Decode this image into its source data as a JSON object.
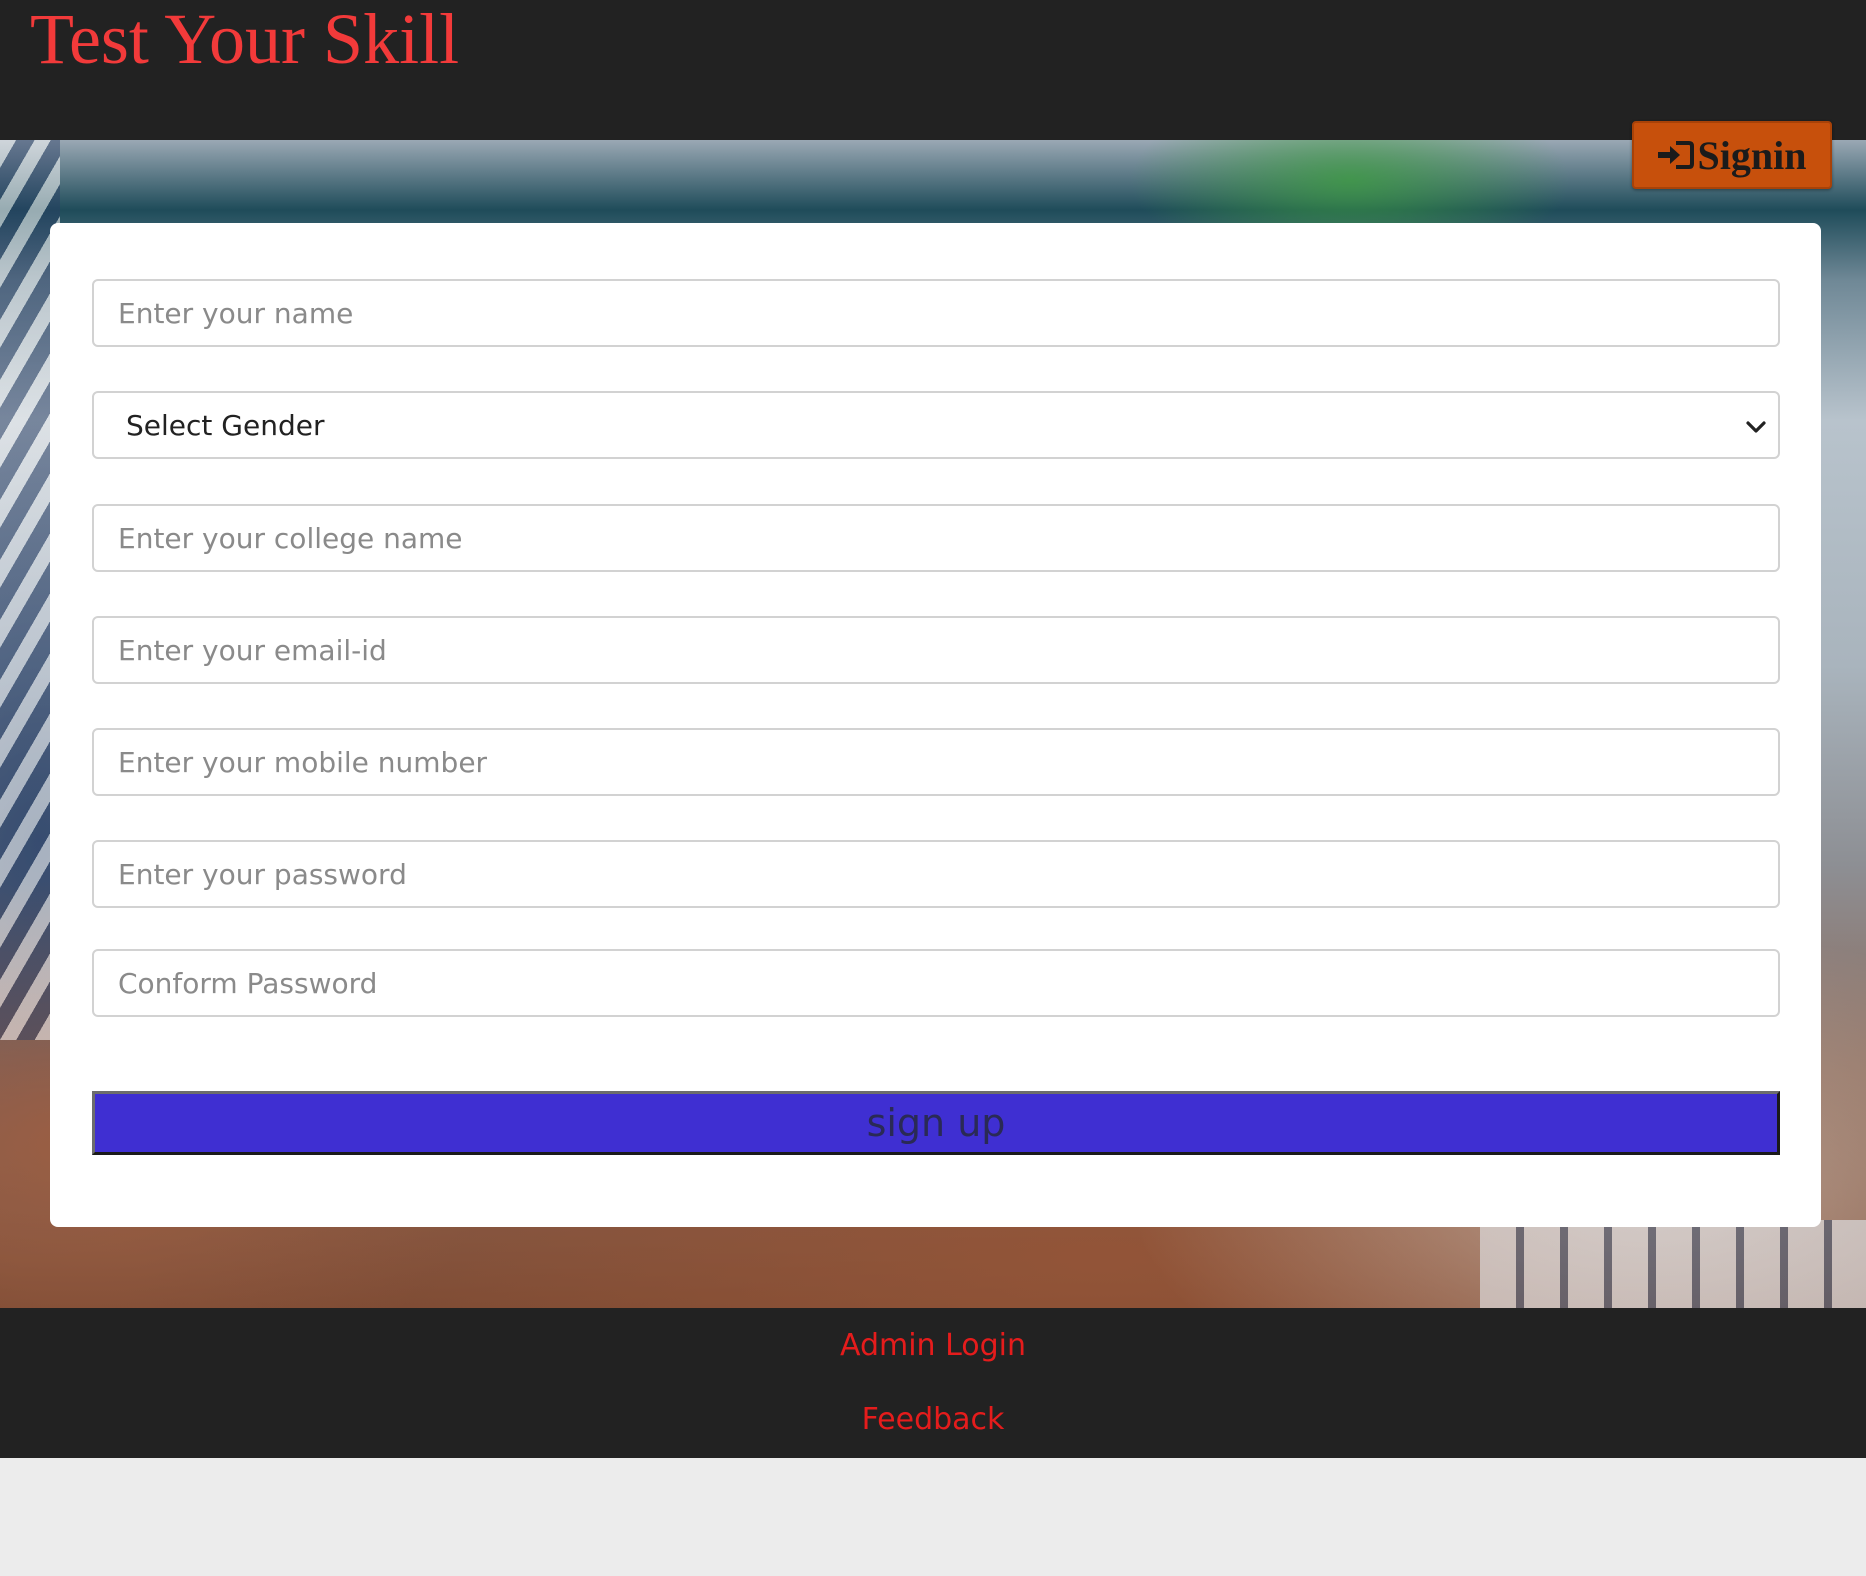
{
  "header": {
    "title": "Test Your Skill",
    "signin_label": "Signin"
  },
  "form": {
    "name_placeholder": "Enter your name",
    "gender_selected": "Select Gender",
    "college_placeholder": "Enter your college name",
    "email_placeholder": "Enter your email-id",
    "mobile_placeholder": "Enter your mobile number",
    "password_placeholder": "Enter your password",
    "confirm_placeholder": "Conform Password",
    "submit_label": "sign up"
  },
  "footer": {
    "links": [
      "Admin Login",
      "Feedback"
    ]
  },
  "colors": {
    "header_bg": "#222222",
    "title": "#f23a3a",
    "signin_bg": "#c7500c",
    "signup_bg": "#3f2fd2",
    "footer_link": "#e51c1c",
    "page_bg": "#ececec"
  },
  "icons": {
    "signin": "sign-in-icon",
    "gender_dropdown": "chevron-down-icon"
  }
}
